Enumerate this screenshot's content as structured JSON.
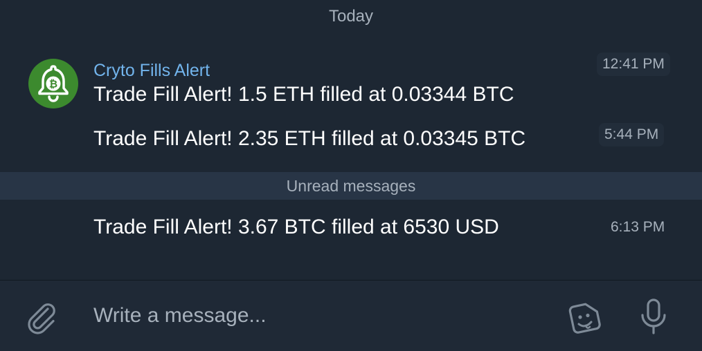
{
  "chat": {
    "date_separator": "Today",
    "sender": "Cryto Fills Alert",
    "avatar_icon": "bitcoin-bell-icon",
    "avatar_color": "#3c8a2e",
    "messages": [
      {
        "text": "Trade Fill Alert! 1.5 ETH filled at 0.03344 BTC",
        "time": "12:41 PM"
      },
      {
        "text": "Trade Fill Alert! 2.35 ETH filled at 0.03345 BTC",
        "time": "5:44 PM"
      },
      {
        "text": "Trade Fill Alert! 3.67 BTC filled at 6530 USD",
        "time": "6:13 PM"
      }
    ],
    "unread_label": "Unread messages"
  },
  "composer": {
    "placeholder": "Write a message...",
    "attach_icon": "paperclip-icon",
    "sticker_icon": "sticker-icon",
    "mic_icon": "microphone-icon"
  },
  "colors": {
    "background": "#1d2733",
    "sender_name": "#72b4ec",
    "unread_bar": "#283546",
    "muted_text": "#a7b1bc"
  }
}
